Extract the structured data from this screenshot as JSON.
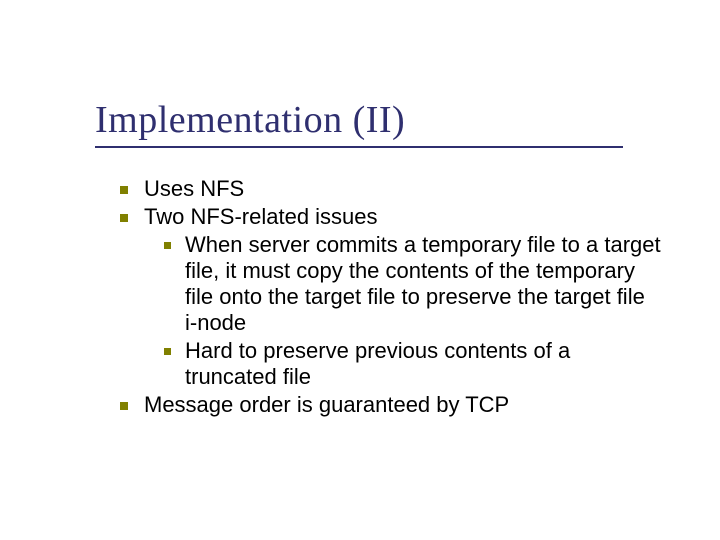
{
  "slide": {
    "title": "Implementation (II)",
    "bullets": {
      "b1": "Uses NFS",
      "b2": "Two NFS-related issues",
      "b2a": "When server commits a temporary file to a target file, it must copy the contents of the temporary file onto the target file to preserve the target file i-node",
      "b2b": "Hard to preserve previous contents of a truncated file",
      "b3": "Message order is guaranteed by TCP"
    }
  }
}
